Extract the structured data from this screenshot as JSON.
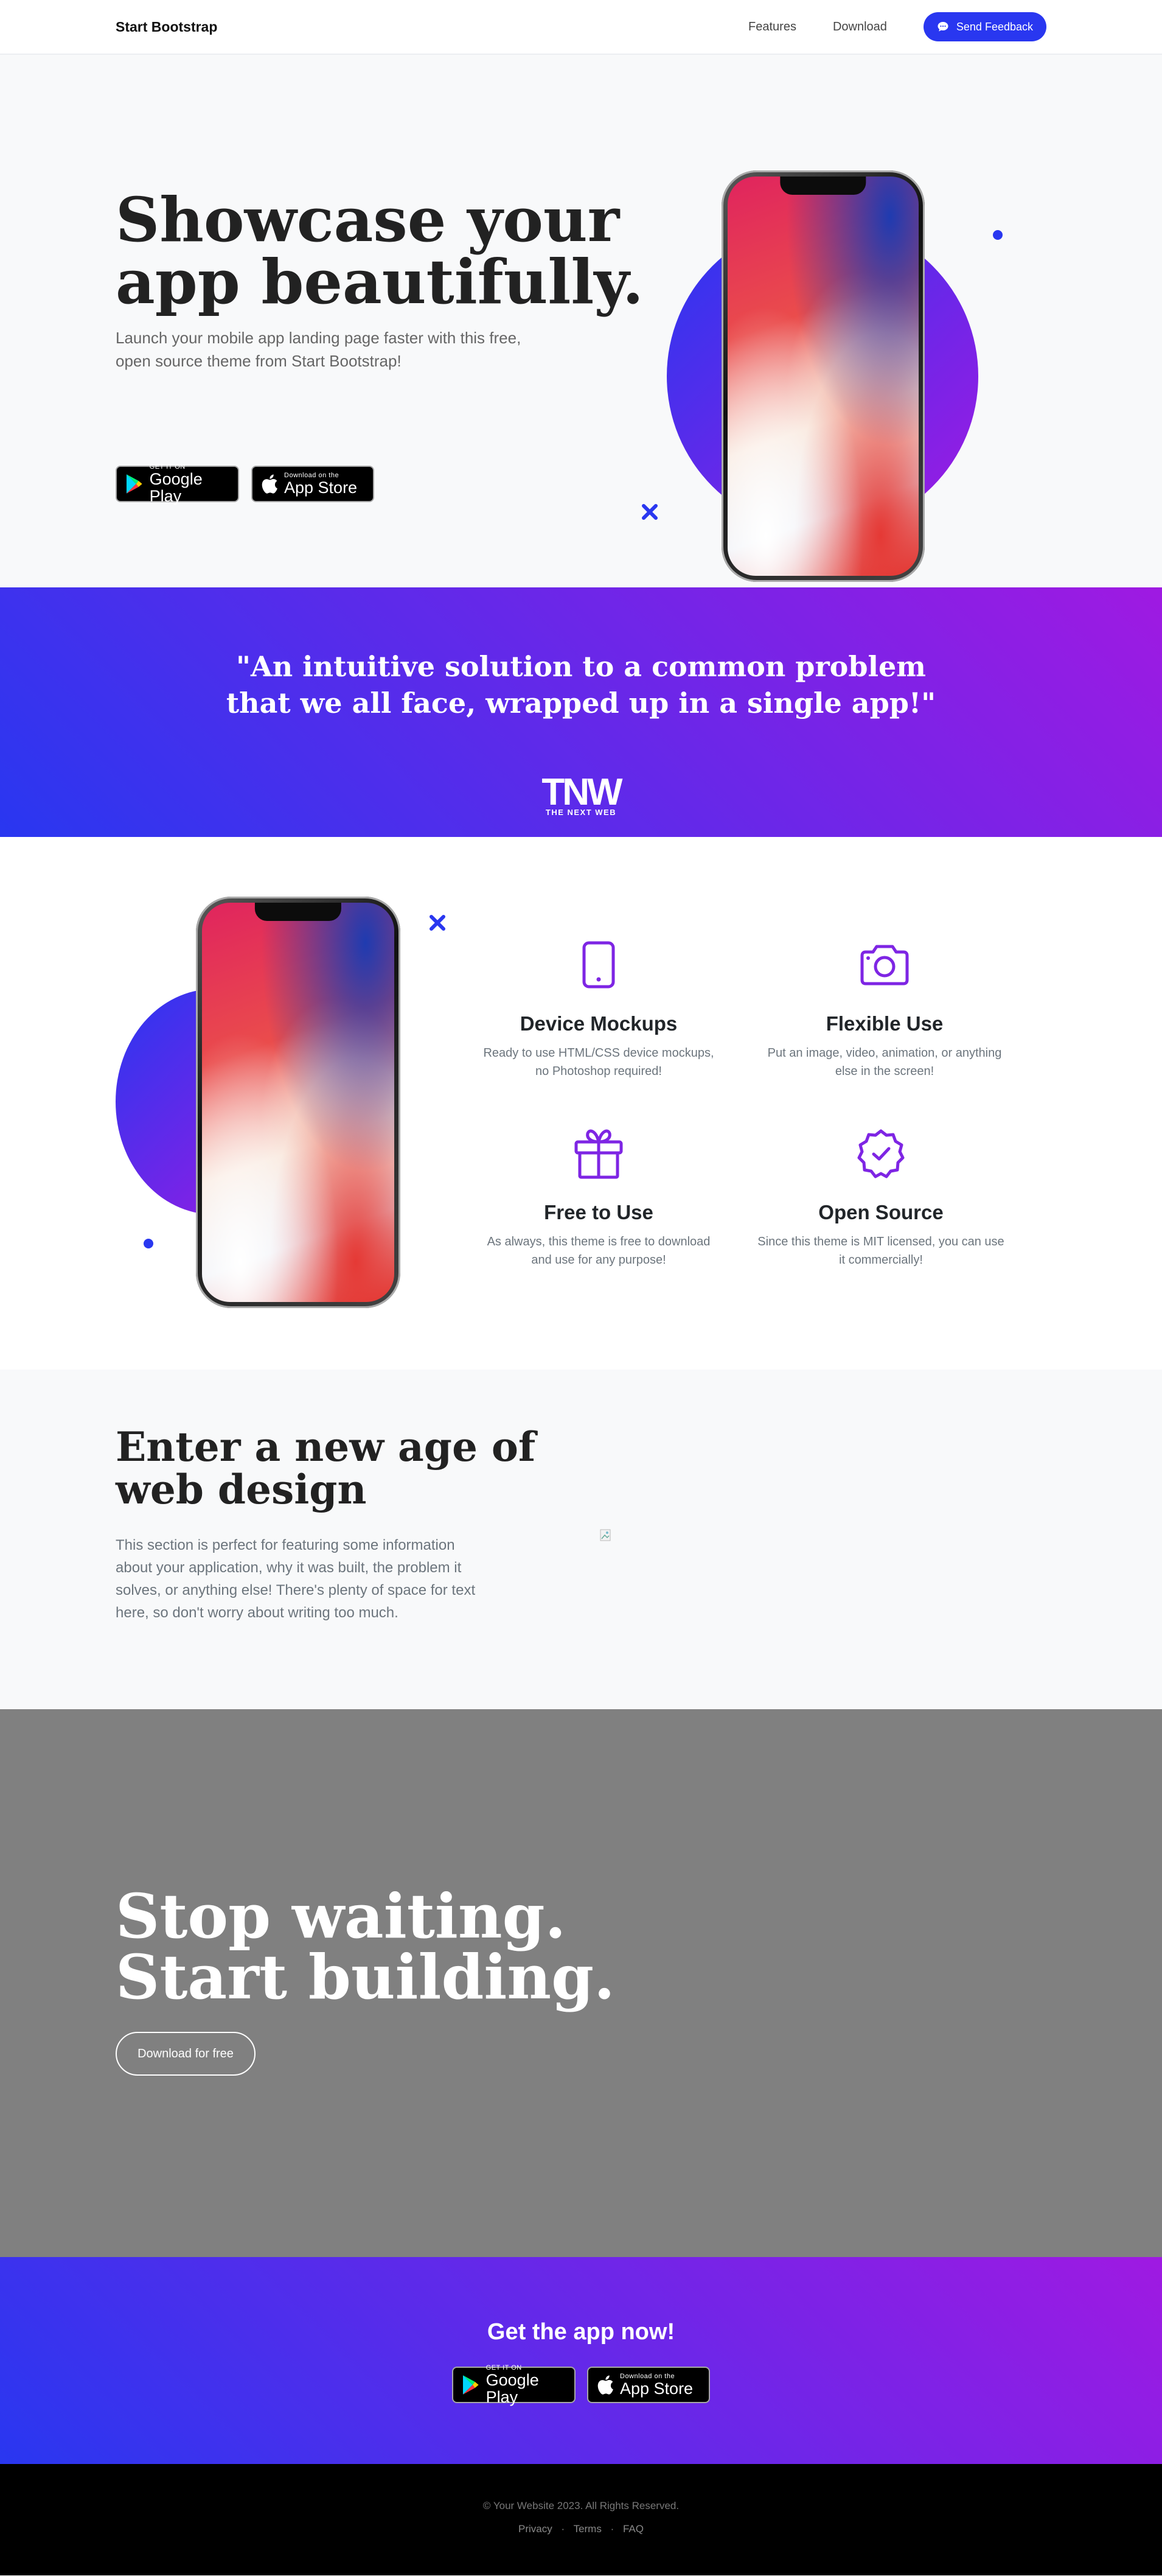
{
  "nav": {
    "brand": "Start Bootstrap",
    "links": [
      "Features",
      "Download"
    ],
    "feedback_button": "Send Feedback"
  },
  "hero": {
    "title_line1": "Showcase your",
    "title_line2": "app beautifully.",
    "subtitle": "Launch your mobile app landing page faster with this free, open source theme from Start Bootstrap!",
    "google_play": {
      "small": "GET IT ON",
      "large": "Google Play"
    },
    "app_store": {
      "small": "Download on the",
      "large": "App Store"
    }
  },
  "quote": {
    "line1": "\"An intuitive solution to a common problem",
    "line2": "that we all face, wrapped up in a single app!\"",
    "logo_text": "TNW",
    "logo_sub": "THE NEXT WEB"
  },
  "features": {
    "items": [
      {
        "title": "Device Mockups",
        "line1": "Ready to use HTML/CSS device mockups,",
        "line2": "no Photoshop required!",
        "icon": "phone-icon"
      },
      {
        "title": "Flexible Use",
        "line1": "Put an image, video, animation, or anything",
        "line2": "else in the screen!",
        "icon": "camera-icon"
      },
      {
        "title": "Free to Use",
        "line1": "As always, this theme is free to download",
        "line2": "and use for any purpose!",
        "icon": "gift-icon"
      },
      {
        "title": "Open Source",
        "line1": "Since this theme is MIT licensed, you can use",
        "line2": "it commercially!",
        "icon": "patch-check-icon"
      }
    ]
  },
  "about": {
    "title_line1": "Enter a new age of",
    "title_line2": "web design",
    "body": "This section is perfect for featuring some information about your application, why it was built, the problem it solves, or anything else! There's plenty of space for text here, so don't worry about writing too much."
  },
  "cta": {
    "title_line1": "Stop waiting.",
    "title_line2": "Start building.",
    "button": "Download for free"
  },
  "getapp": {
    "title": "Get the app now!"
  },
  "footer": {
    "copyright": "© Your Website 2023. All Rights Reserved.",
    "links": [
      "Privacy",
      "Terms",
      "FAQ"
    ],
    "separator": "·"
  },
  "colors": {
    "primary": "#2937f0",
    "secondary": "#9f1ae2",
    "cta_bg": "#808080"
  }
}
